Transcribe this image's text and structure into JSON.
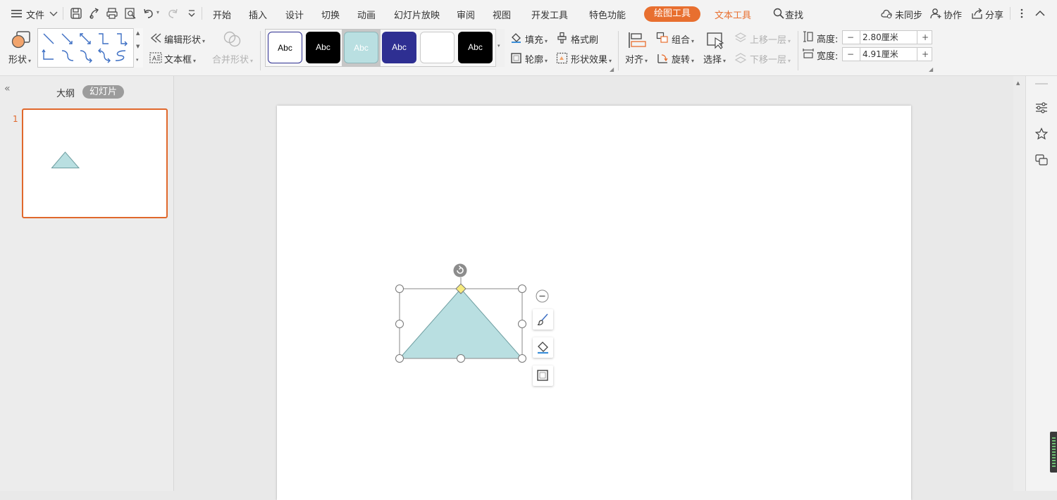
{
  "menu": {
    "file_label": "文件",
    "tabs": [
      {
        "label": "开始"
      },
      {
        "label": "插入"
      },
      {
        "label": "设计"
      },
      {
        "label": "切换"
      },
      {
        "label": "动画"
      },
      {
        "label": "幻灯片放映"
      },
      {
        "label": "审阅"
      },
      {
        "label": "视图"
      },
      {
        "label": "开发工具"
      },
      {
        "label": "特色功能"
      }
    ],
    "context_tab_draw": "绘图工具",
    "context_tab_text": "文本工具",
    "search_label": "查找",
    "sync_label": "未同步",
    "collab_label": "协作",
    "share_label": "分享"
  },
  "ribbon": {
    "shape_label": "形状",
    "edit_shape_label": "编辑形状",
    "textbox_label": "文本框",
    "merge_shape_label": "合并形状",
    "style_samples": [
      "Abc",
      "Abc",
      "Abc",
      "Abc",
      "",
      "Abc"
    ],
    "fill_label": "填充",
    "format_painter_label": "格式刷",
    "outline_label": "轮廓",
    "shape_effect_label": "形状效果",
    "align_label": "对齐",
    "group_label": "组合",
    "rotate_label": "旋转",
    "select_label": "选择",
    "bring_forward_label": "上移一层",
    "send_backward_label": "下移一层",
    "height_label": "高度:",
    "height_value": "2.80厘米",
    "width_label": "宽度:",
    "width_value": "4.91厘米",
    "minus": "−",
    "plus": "+"
  },
  "left_panel": {
    "outline_tab": "大纲",
    "slides_tab": "幻灯片",
    "collapse_glyph": "«",
    "slide_number": "1"
  },
  "colors": {
    "accent": "#e86f2f",
    "shape_fill": "#b9dfe1",
    "shape_stroke": "#6f9ea1",
    "style_navy": "#2e2f92"
  }
}
